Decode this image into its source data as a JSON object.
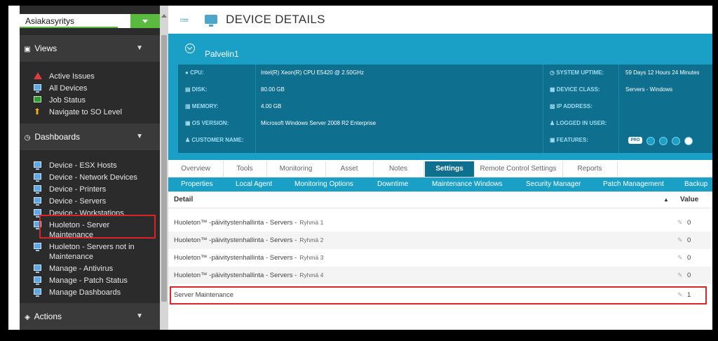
{
  "sidebar": {
    "company": "Asiakasyritys",
    "views_header": "Views",
    "views_items": [
      {
        "label": "Active Issues",
        "icon": "alert-icon"
      },
      {
        "label": "All Devices",
        "icon": "monitor-icon"
      },
      {
        "label": "Job Status",
        "icon": "check-icon"
      },
      {
        "label": "Navigate to SO Level",
        "icon": "arrow-up-icon"
      }
    ],
    "dashboards_header": "Dashboards",
    "dashboard_items": [
      {
        "label": "Device - ESX Hosts"
      },
      {
        "label": "Device - Network Devices"
      },
      {
        "label": "Device - Printers"
      },
      {
        "label": "Device - Servers"
      },
      {
        "label": "Device - Workstations"
      },
      {
        "label": "Huoleton - Server Maintenance"
      },
      {
        "label": "Huoleton - Servers not in Maintenance"
      },
      {
        "label": "Manage - Antivirus"
      },
      {
        "label": "Manage - Patch Status"
      },
      {
        "label": "Manage Dashboards"
      }
    ],
    "actions_header": "Actions"
  },
  "header": {
    "title": "DEVICE DETAILS"
  },
  "device": {
    "hostname": "Palvelin1",
    "left": [
      {
        "label": "CPU:",
        "value": "Intel(R) Xeon(R) CPU E5420 @ 2.50GHz"
      },
      {
        "label": "DISK:",
        "value": "80.00 GB"
      },
      {
        "label": "MEMORY:",
        "value": "4.00 GB"
      },
      {
        "label": "OS VERSION:",
        "value": "Microsoft Windows Server 2008 R2 Enterprise"
      },
      {
        "label": "CUSTOMER NAME:",
        "value": ""
      }
    ],
    "right": [
      {
        "label": "SYSTEM UPTIME:",
        "value": "59 Days 12 Hours 24 Minutes"
      },
      {
        "label": "DEVICE CLASS:",
        "value": "Servers - Windows"
      },
      {
        "label": "IP ADDRESS:",
        "value": ""
      },
      {
        "label": "LOGGED IN USER:",
        "value": ""
      },
      {
        "label": "FEATURES:",
        "value": ""
      }
    ],
    "features_badge": "PRO"
  },
  "tabs": [
    "Overview",
    "Tools",
    "Monitoring",
    "Asset",
    "Notes",
    "Settings",
    "Remote Control Settings",
    "Reports"
  ],
  "active_tab": "Settings",
  "subtabs": [
    "Properties",
    "Local Agent",
    "Monitoring Options",
    "Downtime",
    "Maintenance Windows",
    "Security Manager",
    "Patch Management",
    "Backup"
  ],
  "table": {
    "col_detail": "Detail",
    "col_value": "Value",
    "rows": [
      {
        "detail": "Huoleton™ -päivitystenhallinta - Servers -",
        "group": "Ryhmä 1",
        "value": "0"
      },
      {
        "detail": "Huoleton™ -päivitystenhallinta - Servers -",
        "group": "Ryhmä 2",
        "value": "0"
      },
      {
        "detail": "Huoleton™ -päivitystenhallinta - Servers -",
        "group": "Ryhmä 3",
        "value": "0"
      },
      {
        "detail": "Huoleton™ -päivitystenhallinta - Servers -",
        "group": "Ryhmä 4",
        "value": "0"
      },
      {
        "detail": "Server Maintenance",
        "group": "",
        "value": "1"
      }
    ]
  },
  "colors": {
    "accent": "#1aa0c7",
    "accent_dark": "#0f6f8f",
    "green": "#5ab93f",
    "highlight": "#d9252a"
  }
}
